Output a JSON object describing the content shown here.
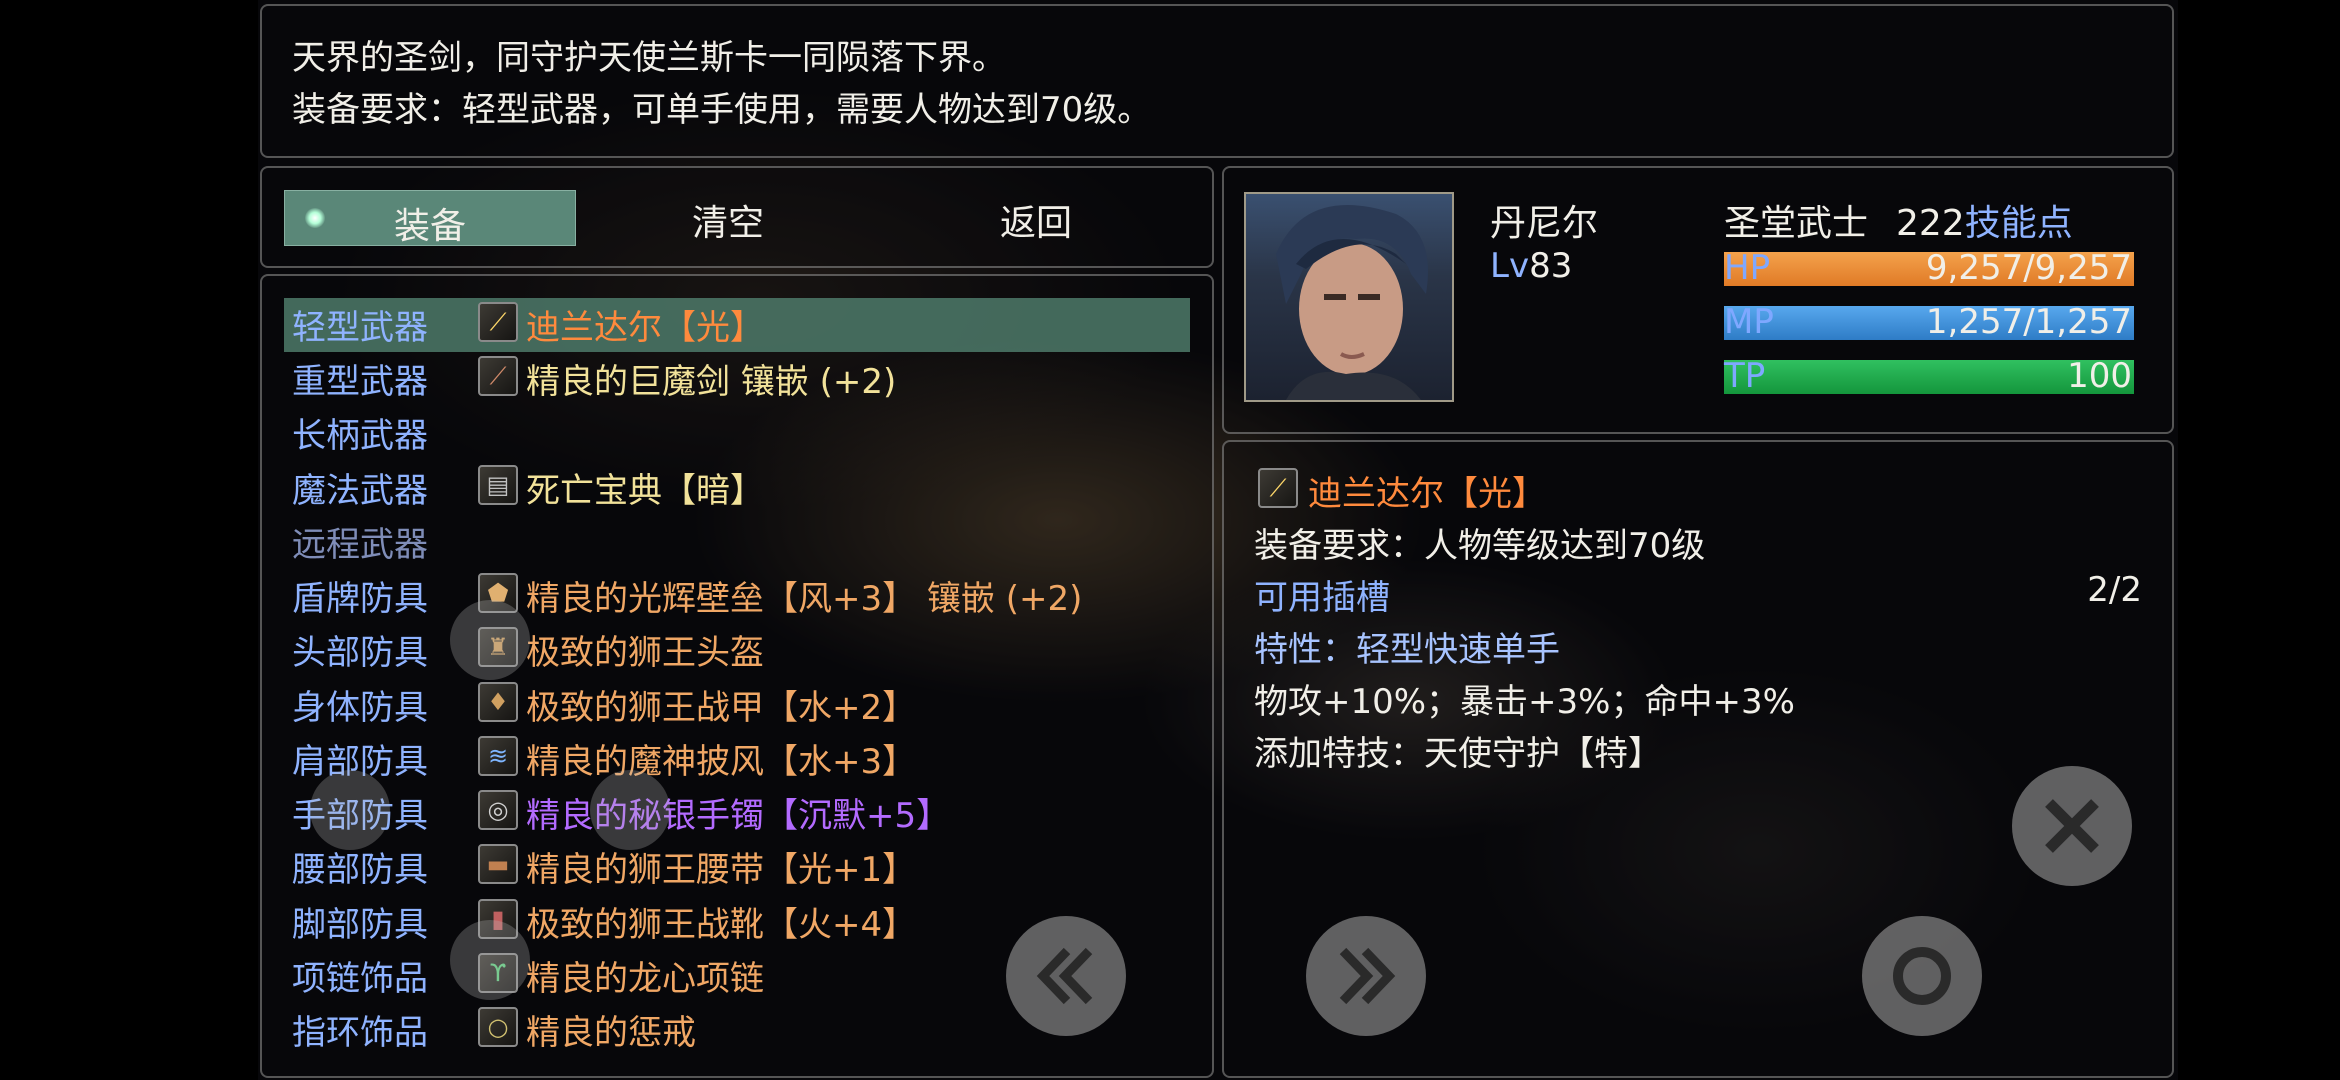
{
  "description": {
    "line1": "天界的圣剑，同守护天使兰斯卡一同陨落下界。",
    "line2": "装备要求：轻型武器，可单手使用，需要人物达到70级。"
  },
  "tabs": {
    "equip": "装备",
    "clear": "清空",
    "back": "返回"
  },
  "slots": [
    {
      "slot": "轻型武器",
      "item": "迪兰达尔【光】",
      "item_color": "orange",
      "icon": "sword-icon",
      "selected": true
    },
    {
      "slot": "重型武器",
      "item": "精良的巨魔剑 镶嵌 (+2)",
      "item_color": "yellow",
      "icon": "greatsword-icon"
    },
    {
      "slot": "长柄武器",
      "item": "",
      "icon": ""
    },
    {
      "slot": "魔法武器",
      "item": "死亡宝典【暗】",
      "item_color": "yellow",
      "icon": "book-icon"
    },
    {
      "slot": "远程武器",
      "item": "",
      "icon": "",
      "dim": true
    },
    {
      "slot": "盾牌防具",
      "item": "精良的光辉壁垒【风+3】 镶嵌 (+2)",
      "item_color": "lorange",
      "icon": "shield-icon"
    },
    {
      "slot": "头部防具",
      "item": "极致的狮王头盔",
      "item_color": "lorange",
      "icon": "helmet-icon"
    },
    {
      "slot": "身体防具",
      "item": "极致的狮王战甲【水+2】",
      "item_color": "lorange",
      "icon": "armor-icon"
    },
    {
      "slot": "肩部防具",
      "item": "精良的魔神披风【水+3】",
      "item_color": "lorange",
      "icon": "cape-icon"
    },
    {
      "slot": "手部防具",
      "item": "精良的秘银手镯【沉默+5】",
      "item_color": "purple",
      "icon": "bracelet-icon"
    },
    {
      "slot": "腰部防具",
      "item": "精良的狮王腰带【光+1】",
      "item_color": "lorange",
      "icon": "belt-icon"
    },
    {
      "slot": "脚部防具",
      "item": "极致的狮王战靴【火+4】",
      "item_color": "lorange",
      "icon": "boots-icon"
    },
    {
      "slot": "项链饰品",
      "item": "精良的龙心项链",
      "item_color": "lorange",
      "icon": "necklace-icon"
    },
    {
      "slot": "指环饰品",
      "item": "精良的惩戒",
      "item_color": "lorange",
      "icon": "ring-icon"
    }
  ],
  "character": {
    "name": "丹尼尔",
    "level_prefix": "Lv",
    "level": "83",
    "class": "圣堂武士",
    "skill_points": "222",
    "skill_points_label": "技能点",
    "hp_label": "HP",
    "hp_text": "9,257/9,257",
    "hp_fraction": 1.0,
    "mp_label": "MP",
    "mp_text": "1,257/1,257",
    "mp_fraction": 1.0,
    "tp_label": "TP",
    "tp_text": "100",
    "tp_fraction": 1.0
  },
  "detail": {
    "item_name": "迪兰达尔【光】",
    "requirement": "装备要求：人物等级达到70级",
    "slots_label": "可用插槽",
    "slots_value": "2/2",
    "trait": "特性：轻型快速单手",
    "stats": "物攻+10%；暴击+3%；命中+3%",
    "skill": "添加特技：天使守护【特】"
  },
  "colors": {
    "hp": "#f0923a",
    "mp": "#3d8fd6",
    "tp": "#1ea64a",
    "selected_row": "#4e7a6a",
    "accent_blue": "#8fb3ff"
  }
}
